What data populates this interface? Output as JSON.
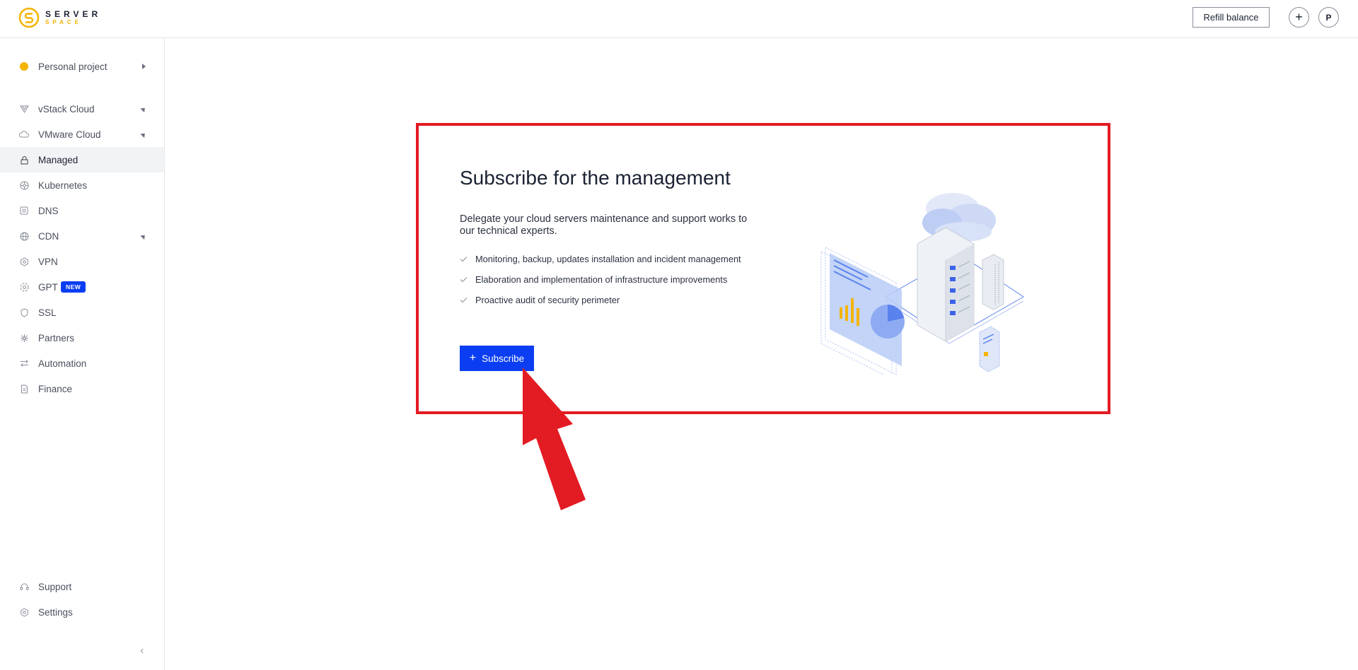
{
  "header": {
    "logo_line1": "SERVER",
    "logo_line2": "SPACE",
    "refill_label": "Refill balance",
    "add_label": "+",
    "avatar_initial": "P"
  },
  "sidebar": {
    "project": "Personal project",
    "items": [
      {
        "label": "vStack Cloud"
      },
      {
        "label": "VMware Cloud"
      },
      {
        "label": "Managed"
      },
      {
        "label": "Kubernetes"
      },
      {
        "label": "DNS"
      },
      {
        "label": "CDN"
      },
      {
        "label": "VPN"
      },
      {
        "label": "GPT",
        "badge": "NEW"
      },
      {
        "label": "SSL"
      },
      {
        "label": "Partners"
      },
      {
        "label": "Automation"
      },
      {
        "label": "Finance"
      }
    ],
    "bottom": [
      {
        "label": "Support"
      },
      {
        "label": "Settings"
      }
    ],
    "collapse_glyph": "‹"
  },
  "main": {
    "title": "Subscribe for the management",
    "description": "Delegate your cloud servers maintenance and support works to our technical experts.",
    "features": [
      "Monitoring, backup, updates installation and incident management",
      "Elaboration and implementation of infrastructure improvements",
      "Proactive audit of security perimeter"
    ],
    "subscribe_label": "Subscribe"
  },
  "colors": {
    "accent": "#0b3ef2",
    "highlight": "#e31b23",
    "brand_yellow": "#f4b400"
  }
}
